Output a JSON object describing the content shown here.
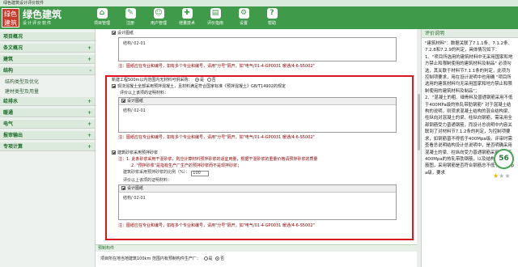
{
  "window": {
    "title": "绿色建筑设计评价软件"
  },
  "logo": {
    "mark": "绿色\n建筑",
    "name": "绿色建筑",
    "sub": "设计评价软件"
  },
  "toolbar": [
    {
      "icon": "⌂",
      "label": "项目管理",
      "name": "project-management"
    },
    {
      "icon": "✎",
      "label": "注册",
      "name": "register"
    },
    {
      "icon": "☺",
      "label": "用户管理",
      "name": "user-management"
    },
    {
      "icon": "✚",
      "label": "增量技术",
      "name": "incremental-tech"
    },
    {
      "icon": "▤",
      "label": "评价指南",
      "name": "evaluation-guide"
    },
    {
      "icon": "⚙",
      "label": "设置",
      "name": "settings"
    },
    {
      "icon": "?",
      "label": "帮助",
      "name": "help"
    }
  ],
  "nav": [
    {
      "label": "项目概况",
      "type": "hdr",
      "plus": ""
    },
    {
      "label": "条文概况",
      "type": "hdr",
      "plus": "+"
    },
    {
      "label": "建筑",
      "type": "hdr",
      "plus": "+"
    },
    {
      "label": "结构",
      "type": "hdr",
      "plus": "-"
    },
    {
      "label": "结构类型及优化",
      "type": "sub",
      "plus": ""
    },
    {
      "label": "建材类型及用量",
      "type": "sub",
      "plus": ""
    },
    {
      "label": "给排水",
      "type": "hdr",
      "plus": "+"
    },
    {
      "label": "暖通",
      "type": "hdr",
      "plus": "+"
    },
    {
      "label": "电气",
      "type": "hdr",
      "plus": "+"
    },
    {
      "label": "报审输出",
      "type": "hdr",
      "plus": "+"
    },
    {
      "label": "专项计算",
      "type": "hdr",
      "plus": "+"
    }
  ],
  "main": {
    "top_check": "设计图纸",
    "top_box_text": "结构/ 02-01",
    "top_hint": "注：图纸应在专业和编号，如有多个专业和编号，请用\"分号\"隔开，如\"电气/01-4-GP0031 暖通/4-6-S5002\"",
    "q1": "新建工程500m以内范围内无材料可供采购：",
    "q1_yes": "是",
    "q1_no": "否",
    "q2": "现浇混凝土全部采用预拌混凝土，且材料满足符合国家标准《预拌混凝土》GB/T14902的规定",
    "q2_sub": "评价以上该项的证明材料：",
    "box1_head": "设计图纸",
    "box1_text": "结构/ 02-01",
    "hint1": "注：图纸应在专业和编号，如有多个专业和编号，请用\"分号\"隔开，如\"电气/01-4-GP0031 暖通/4-6-S5002\"",
    "q3": "建筑砂浆采用预拌砂浆",
    "note1": "注：1. 此条砂浆采用干混砂浆，则应计算材料预拌砂浆的适宜用量，根据干混砂浆的重量价格请预拌砂浆的质量",
    "note2": "2. \"预拌砂浆\"是指有生产厂生产的预拌砂浆而不是现拌砂浆；",
    "ratio_label": "建筑砂浆采用预拌砂浆的比例（%）：",
    "ratio_value": "100",
    "q3_sub": "评价以上该项的证明材料：",
    "box2_head": "设计图纸",
    "box2_text": "结构/ 02-01",
    "hint2": "注：图纸应在专业和编号，如有多个专业和编号，请用\"分号\"隔开，如\"电气/01-4-GP0031 暖通/4-6-S5002\"",
    "section_bar": "预制构件",
    "bottom_q": "项目所在地当地建筑100km 范围内有预制构件生产厂：",
    "bottom_yes": "是",
    "bottom_no": "否"
  },
  "right": {
    "title": "评价说明",
    "text": [
      "\"建筑材料\"：数据关联了7.1.1条、7.1.2条、7.2.8和7.2.9的判定，具体情况如下：",
      "1、\"项目所选用的建筑材料中无采用国家和地方禁止和限制使用的建筑材料及制品\" 必须勾选，其关联于材料节7.1.1条的判定，此项为控制项要求，用在设计说明中也用确 \"项目所选用的建筑材料均无采用国家和地方禁止和限制使用的建筑材料及制品\"；",
      "2、\"混凝土的粗、细骨料及普通钢筋采用不低于400MPa级的热轧带肋钢筋\" 对于混凝土结构的说明，则须求混凝土结构的混合结构梁、柱纵向对混凝土的梁、柱纵向钢筋，需采用全部钢筋受力普通钢筋，而设计总说明中内容关联到了对材料节7.1.2条的判定，为控制项要求，如钢筋普不得低于400Mpa级。评审时需查看总说明结构设计总说明中，是否明确采用混凝土的梁、柱纵向受力普通钢筋采用不低于400Mpa的热轧带肋钢筋，以及结构梁、柱配筋图，采用钢筋是否符合钢筋总不低于400Mpa级，要求"
    ],
    "score": "56",
    "stars_filled": 1,
    "stars_total": 3
  }
}
